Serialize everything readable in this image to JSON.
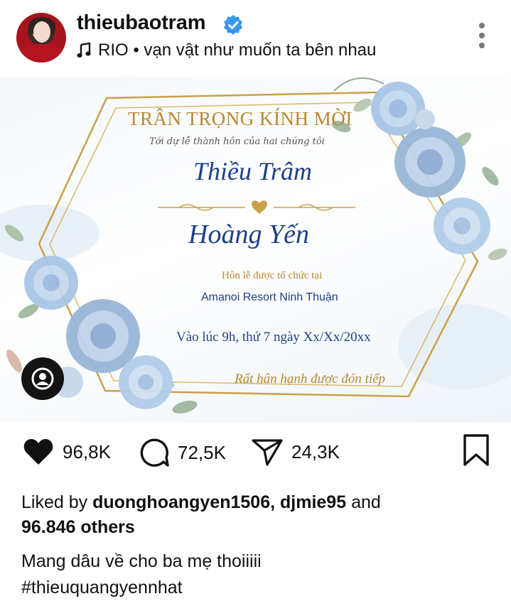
{
  "header": {
    "username": "thieubaotram",
    "music": "RIO • vạn vật như muốn ta bên nhau"
  },
  "invitation": {
    "title": "TRÂN TRỌNG KÍNH MỜI",
    "subtitle": "Tới dự lễ thành hôn của hai chúng tôi",
    "name1": "Thiều Trâm",
    "name2": "Hoàng Yến",
    "held_at": "Hôn lễ được tổ chức tại",
    "venue": "Amanoi Resort Ninh Thuận",
    "time": "Vào lúc 9h, thứ 7 ngày Xx/Xx/20xx",
    "welcome": "Rất hân hạnh được đón tiếp"
  },
  "actions": {
    "likes": "96,8K",
    "comments": "72,5K",
    "shares": "24,3K"
  },
  "liked_by": {
    "prefix": "Liked by",
    "user1": "duonghoangyen1506,",
    "user2": "djmie95",
    "and": "and",
    "others": "96.846 others"
  },
  "caption": {
    "text": "Mang dâu về cho ba mẹ thoiiiii",
    "hashtag": "#thieuquangyennhat"
  },
  "colors": {
    "gold": "#b8892e",
    "navy": "#1d3f86",
    "verified": "#3897f0"
  }
}
